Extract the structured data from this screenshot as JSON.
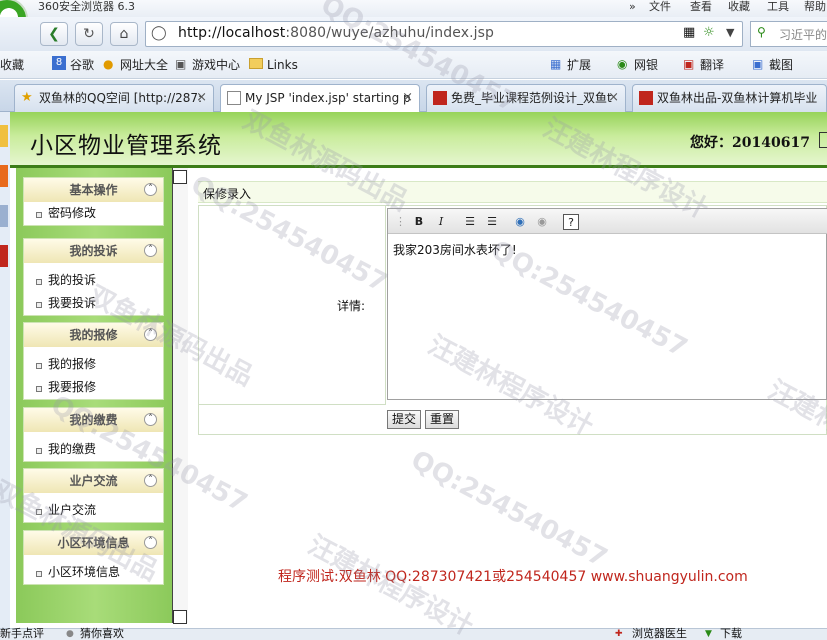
{
  "browser": {
    "title": "360安全浏览器 6.3",
    "menu": [
      "»",
      "文件",
      "查看",
      "收藏",
      "工具",
      "帮助"
    ],
    "url_host": "http://localhost",
    "url_rest": ":8080/wuye/azhuhu/index.jsp",
    "search_placeholder": "习近平的",
    "bookmarks": [
      "收藏",
      "谷歌",
      "网址大全",
      "游戏中心",
      "Links"
    ],
    "tools": [
      "扩展",
      "网银",
      "翻译",
      "截图"
    ],
    "tabs": [
      {
        "label": "双鱼林的QQ空间 [http://287:"
      },
      {
        "label": "My JSP 'index.jsp' starting p"
      },
      {
        "label": "免费_毕业课程范例设计_双鱼t"
      },
      {
        "label": "双鱼林出品-双鱼林计算机毕业"
      }
    ],
    "status_left": [
      "新手点评",
      "猜你喜欢"
    ],
    "status_right": [
      "浏览器医生",
      "下载"
    ]
  },
  "header": {
    "title": "小区物业管理系统",
    "greeting": "您好：20140617"
  },
  "sidebar": {
    "sections": [
      {
        "title": "基本操作",
        "items": [
          "密码修改"
        ]
      },
      {
        "title": "我的投诉",
        "items": [
          "我的投诉",
          "我要投诉"
        ]
      },
      {
        "title": "我的报修",
        "items": [
          "我的报修",
          "我要报修"
        ]
      },
      {
        "title": "我的缴费",
        "items": [
          "我的缴费"
        ]
      },
      {
        "title": "业户交流",
        "items": [
          "业户交流"
        ]
      },
      {
        "title": "小区环境信息",
        "items": [
          "小区环境信息"
        ]
      }
    ]
  },
  "form": {
    "breadcrumb": "保修录入",
    "detail_label": "详情:",
    "detail_value": "我家203房间水表坏了!",
    "submit": "提交",
    "reset": "重置",
    "toolbar_bold": "B",
    "toolbar_italic": "I"
  },
  "footer": {
    "note": "程序测试:双鱼林 QQ:287307421或254540457 www.shuangyulin.com"
  },
  "watermarks": [
    "QQ:254540457",
    "汪建林程序设计",
    "双鱼林源码出品",
    "QQ:254540457",
    "汪建林程序设计",
    "双鱼林源码出品",
    "QQ:254540457",
    "汪建林程序设计",
    "QQ:254540457",
    "双鱼林源码出品",
    "QQ:254540457",
    "汪建林程序设计"
  ],
  "colors": {
    "header_green": "#97d35a",
    "footer_red": "#c0261d",
    "sidebar_green": "#8bc95a"
  }
}
